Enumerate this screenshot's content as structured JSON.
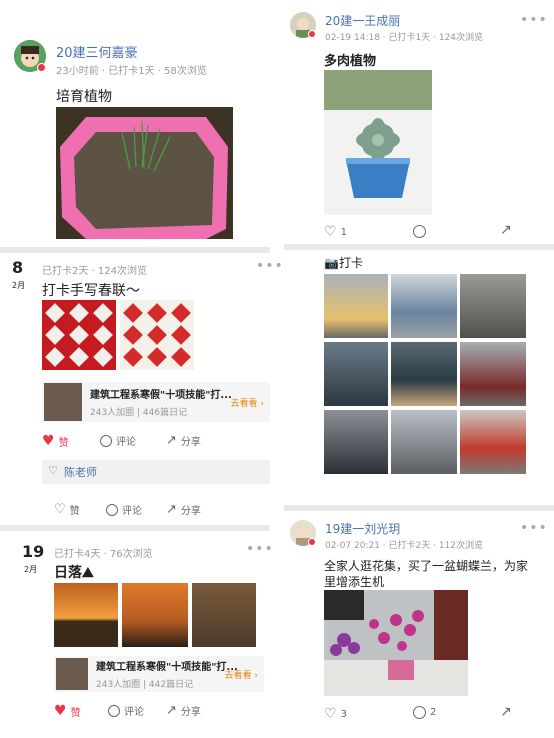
{
  "post1": {
    "author": "20建三何嘉豪",
    "meta": "23小时前 · 已打卡1天 · 58次浏览",
    "text": "培育植物"
  },
  "post2": {
    "day": "8",
    "month": "2月",
    "meta": "已打卡2天 · 124次浏览",
    "text": "打卡手写春联～",
    "project_title": "建筑工程系寒假\"十项技能\"打...",
    "project_stats": "243人加圈 | 446篇日记",
    "project_go": "去看看",
    "like": "赞",
    "comment": "评论",
    "share": "分享",
    "liker": "陈老师",
    "like2": "赞",
    "comment2": "评论",
    "share2": "分享"
  },
  "post3": {
    "day": "19",
    "month": "2月",
    "meta": "已打卡4天 · 76次浏览",
    "text": "日落⛰",
    "project_title": "建筑工程系寒假\"十项技能\"打...",
    "project_stats": "243人加圈 | 442篇日记",
    "project_go": "去看看",
    "like": "赞",
    "comment": "评论",
    "share": "分享"
  },
  "post4": {
    "author": "20建一王成丽",
    "meta": "02-19 14:18 · 已打卡1天 · 124次浏览",
    "text": "多肉植物",
    "like_count": "1"
  },
  "post5": {
    "text": "📷打卡"
  },
  "post6": {
    "author": "19建一刘光玥",
    "meta": "02-07 20:21 · 已打卡2天 · 112次浏览",
    "text": "全家人逛花集，买了一盆蝴蝶兰，为家里增添生机",
    "like_count": "3",
    "comment_count": "2"
  },
  "colors": {
    "name_blue": "#4a72b0",
    "like_red": "#e8364a",
    "go_orange": "#e8850c"
  }
}
